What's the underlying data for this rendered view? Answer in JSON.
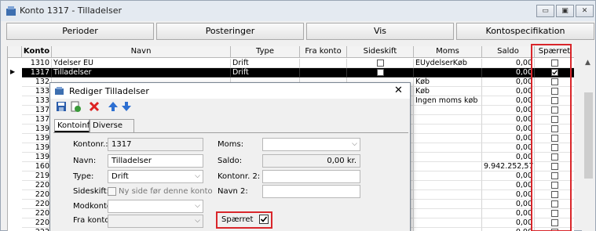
{
  "window": {
    "title": "Konto 1317 - Tilladelser",
    "controls": [
      "▭",
      "▣",
      "✕"
    ]
  },
  "nav_buttons": [
    "Perioder",
    "Posteringer",
    "Vis",
    "Kontospecifikation"
  ],
  "grid": {
    "columns": [
      "Konto",
      "Navn",
      "Type",
      "Fra konto",
      "Sideskift",
      "Moms",
      "Saldo",
      "Spærret"
    ],
    "rows": [
      {
        "konto": "1310",
        "navn": "Ydelser EU",
        "type": "Drift",
        "moms": "EUydelserKøb",
        "saldo": "0,00",
        "sideskift_check": true,
        "spaerret": false,
        "selected": false
      },
      {
        "konto": "1317",
        "navn": "Tilladelser",
        "type": "Drift",
        "moms": "",
        "saldo": "0,00",
        "sideskift_check": true,
        "spaerret": true,
        "selected": true
      },
      {
        "konto": "132",
        "navn": "",
        "type": "",
        "moms": "Køb",
        "saldo": "0,00",
        "sideskift_check": false,
        "spaerret": false,
        "selected": false
      },
      {
        "konto": "133",
        "navn": "",
        "type": "",
        "moms": "Køb",
        "saldo": "0,00",
        "sideskift_check": false,
        "spaerret": false,
        "selected": false
      },
      {
        "konto": "133",
        "navn": "",
        "type": "",
        "moms": "Ingen moms køb",
        "saldo": "0,00",
        "sideskift_check": false,
        "spaerret": false,
        "selected": false
      },
      {
        "konto": "137",
        "navn": "",
        "type": "",
        "moms": "",
        "saldo": "0,00",
        "sideskift_check": false,
        "spaerret": false,
        "selected": false
      },
      {
        "konto": "137",
        "navn": "",
        "type": "",
        "moms": "",
        "saldo": "0,00",
        "sideskift_check": false,
        "spaerret": false,
        "selected": false
      },
      {
        "konto": "139",
        "navn": "",
        "type": "",
        "moms": "",
        "saldo": "0,00",
        "sideskift_check": false,
        "spaerret": false,
        "selected": false
      },
      {
        "konto": "139",
        "navn": "",
        "type": "",
        "moms": "",
        "saldo": "0,00",
        "sideskift_check": false,
        "spaerret": false,
        "selected": false
      },
      {
        "konto": "139",
        "navn": "",
        "type": "",
        "moms": "",
        "saldo": "0,00",
        "sideskift_check": false,
        "spaerret": false,
        "selected": false
      },
      {
        "konto": "139",
        "navn": "",
        "type": "",
        "moms": "",
        "saldo": "0,00",
        "sideskift_check": false,
        "spaerret": false,
        "selected": false
      },
      {
        "konto": "160",
        "navn": "",
        "type": "",
        "moms": "",
        "saldo": "9.942.252,57",
        "sideskift_check": false,
        "spaerret": false,
        "selected": false
      },
      {
        "konto": "219",
        "navn": "",
        "type": "",
        "moms": "",
        "saldo": "0,00",
        "sideskift_check": false,
        "spaerret": false,
        "selected": false
      },
      {
        "konto": "220",
        "navn": "",
        "type": "",
        "moms": "",
        "saldo": "0,00",
        "sideskift_check": false,
        "spaerret": false,
        "selected": false
      },
      {
        "konto": "220",
        "navn": "",
        "type": "",
        "moms": "",
        "saldo": "0,00",
        "sideskift_check": false,
        "spaerret": false,
        "selected": false
      },
      {
        "konto": "220",
        "navn": "",
        "type": "",
        "moms": "",
        "saldo": "0,00",
        "sideskift_check": false,
        "spaerret": false,
        "selected": false
      },
      {
        "konto": "220",
        "navn": "",
        "type": "",
        "moms": "",
        "saldo": "0,00",
        "sideskift_check": false,
        "spaerret": false,
        "selected": false
      },
      {
        "konto": "220",
        "navn": "",
        "type": "",
        "moms": "",
        "saldo": "0,00",
        "sideskift_check": false,
        "spaerret": false,
        "selected": false
      },
      {
        "konto": "222",
        "navn": "",
        "type": "",
        "moms": "",
        "saldo": "0,00",
        "sideskift_check": false,
        "spaerret": false,
        "selected": false
      }
    ]
  },
  "dialog": {
    "title": "Rediger Tilladelser",
    "close": "✕",
    "tabs": [
      "Kontoinfo",
      "Diverse info"
    ],
    "fields": {
      "kontonr_label": "Kontonr.:",
      "kontonr_value": "1317",
      "navn_label": "Navn:",
      "navn_value": "Tilladelser",
      "type_label": "Type:",
      "type_value": "Drift",
      "sideskift_label": "Sideskift:",
      "sideskift_text": "Ny side før denne konto",
      "modkonto_label": "Modkonto:",
      "modkonto_value": "",
      "frakonto_label": "Fra konto:",
      "frakonto_value": "",
      "moms_label": "Moms:",
      "moms_value": "",
      "saldo_label": "Saldo:",
      "saldo_value": "0,00 kr.",
      "kontonr2_label": "Kontonr. 2:",
      "kontonr2_value": "",
      "navn2_label": "Navn 2:",
      "navn2_value": "",
      "spaerret_label": "Spærret",
      "spaerret_checked": true
    }
  },
  "colors": {
    "highlight_red": "#d9262b",
    "selected_row": "#000000"
  }
}
